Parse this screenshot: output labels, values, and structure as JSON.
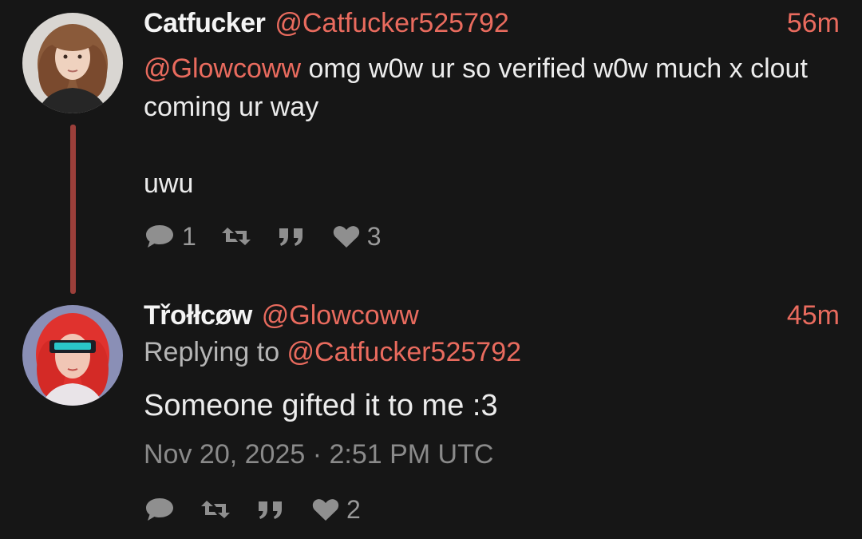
{
  "accent": "#e96b5e",
  "background": "#161616",
  "posts": [
    {
      "display_name": "Catfucker",
      "handle": "@Catfucker525792",
      "time": "56m",
      "mention": "@Glowcoww",
      "text": " omg w0w ur so verified w0w much x clout coming ur way",
      "text2": "uwu",
      "actions": {
        "reply_icon": "comment-icon",
        "reply_count": "1",
        "retweet_icon": "retweet-icon",
        "quote_icon": "quote-icon",
        "like_icon": "heart-icon",
        "like_count": "3"
      }
    },
    {
      "display_name": "Třołłcøw",
      "handle": "@Glowcoww",
      "time": "45m",
      "replying_prefix": "Replying to ",
      "replying_to": "@Catfucker525792",
      "text": "Someone gifted it to me :3",
      "date": "Nov 20, 2025 · 2:51 PM UTC",
      "actions": {
        "reply_icon": "comment-icon",
        "retweet_icon": "retweet-icon",
        "quote_icon": "quote-icon",
        "like_icon": "heart-icon",
        "like_count": "2"
      }
    }
  ]
}
